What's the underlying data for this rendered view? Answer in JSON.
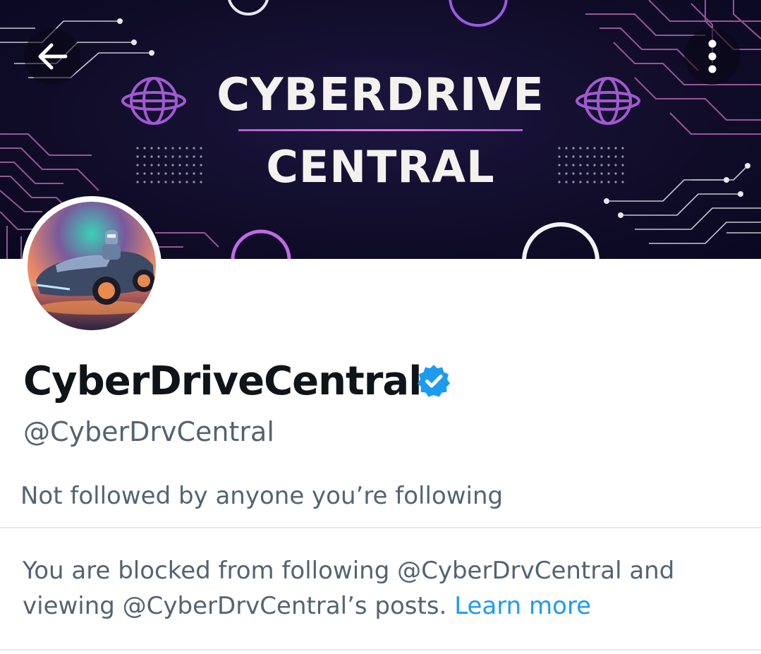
{
  "banner": {
    "title_line1": "CYBERDRIVE",
    "title_line2": "CENTRAL",
    "accent_color": "#b05fd0"
  },
  "navigation": {
    "back_icon": "arrow-left-icon",
    "more_icon": "more-vertical-icon"
  },
  "profile": {
    "display_name": "CyberDriveCentral",
    "verified_icon": "verified-badge-icon",
    "verified_color": "#1d9bf0",
    "handle": "@CyberDrvCentral",
    "followers_note": "Not followed by anyone you’re following"
  },
  "block_notice": {
    "text": "You are blocked from following @CyberDrvCentral and viewing @CyberDrvCentral’s posts.",
    "link_label": "Learn more",
    "link_color": "#1d9bf0"
  }
}
